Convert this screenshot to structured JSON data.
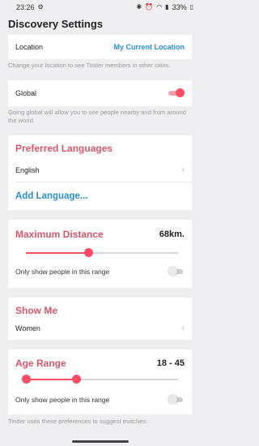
{
  "status_bar": {
    "time": "23:26",
    "battery": "33%"
  },
  "title": "Discovery Settings",
  "location": {
    "label": "Location",
    "value": "My Current Location",
    "caption": "Change your location to see Tinder members in other cities."
  },
  "global": {
    "label": "Global",
    "enabled": true,
    "caption": "Going global will allow you to see people nearby and from around the world."
  },
  "languages": {
    "heading": "Preferred Languages",
    "items": [
      "English"
    ],
    "add_label": "Add Language..."
  },
  "max_distance": {
    "heading": "Maximum Distance",
    "value": "68km.",
    "fraction": 0.41,
    "only_label": "Only show people in this range",
    "only_enabled": false
  },
  "show_me": {
    "heading": "Show Me",
    "value": "Women"
  },
  "age_range": {
    "heading": "Age Range",
    "value": "18 - 45",
    "min_fraction": 0.0,
    "max_fraction": 0.33,
    "only_label": "Only show people in this range",
    "only_enabled": false
  },
  "footer_note": "Tinder uses these preferences to suggest matches.",
  "colors": {
    "accent": "#fd4c64",
    "heading": "#d9566c",
    "link": "#2a8fd2",
    "background": "#efeff2"
  },
  "icons": {
    "status_left": [
      "gear-icon"
    ],
    "status_right": [
      "bluetooth-icon",
      "alarm-icon",
      "wifi-icon",
      "signal-icon",
      "battery-icon"
    ],
    "row_chevron": "chevron-right-icon"
  }
}
